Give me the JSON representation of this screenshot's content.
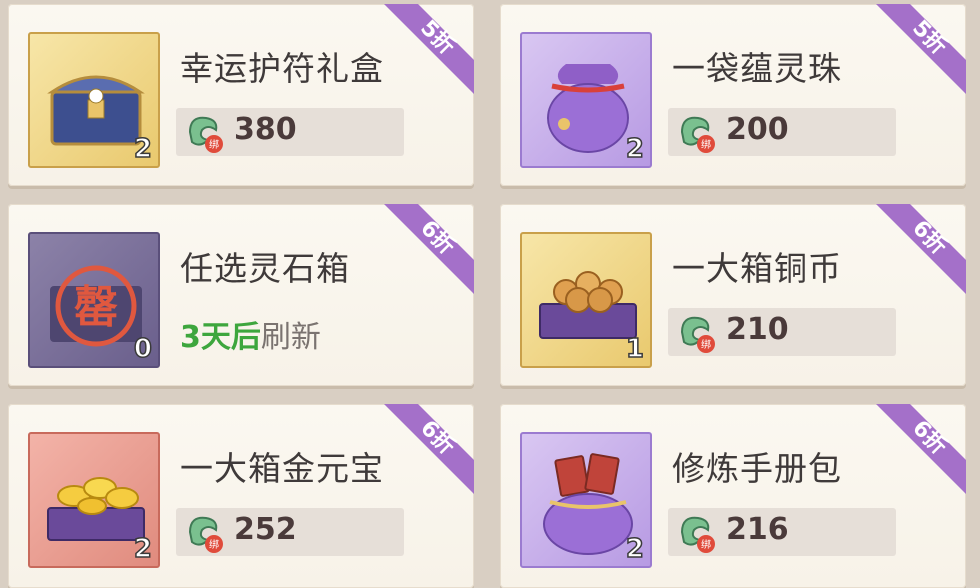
{
  "items": [
    {
      "name": "幸运护符礼盒",
      "qty": "2",
      "price": "380",
      "discount": "5折",
      "quality": "gold",
      "icon": "treasure-chest-icon"
    },
    {
      "name": "一袋蕴灵珠",
      "qty": "2",
      "price": "200",
      "discount": "5折",
      "quality": "purple",
      "icon": "pouch-icon"
    },
    {
      "name": "任选灵石箱",
      "qty": "0",
      "discount": "6折",
      "quality": "dark",
      "icon": "sold-out-box-icon",
      "sold_out_stamp": "罄",
      "refresh_green": "3天后",
      "refresh_gray": "刷新"
    },
    {
      "name": "一大箱铜币",
      "qty": "1",
      "price": "210",
      "discount": "6折",
      "quality": "gold",
      "icon": "copper-coin-box-icon"
    },
    {
      "name": "一大箱金元宝",
      "qty": "2",
      "price": "252",
      "discount": "6折",
      "quality": "red",
      "icon": "gold-ingot-box-icon"
    },
    {
      "name": "修炼手册包",
      "qty": "2",
      "price": "216",
      "discount": "6折",
      "quality": "purple",
      "icon": "manual-pouch-icon"
    }
  ],
  "currency": {
    "icon": "bound-jade-icon",
    "label": "绑"
  },
  "colors": {
    "ribbon": "#a470c9",
    "green": "#3da63d"
  }
}
